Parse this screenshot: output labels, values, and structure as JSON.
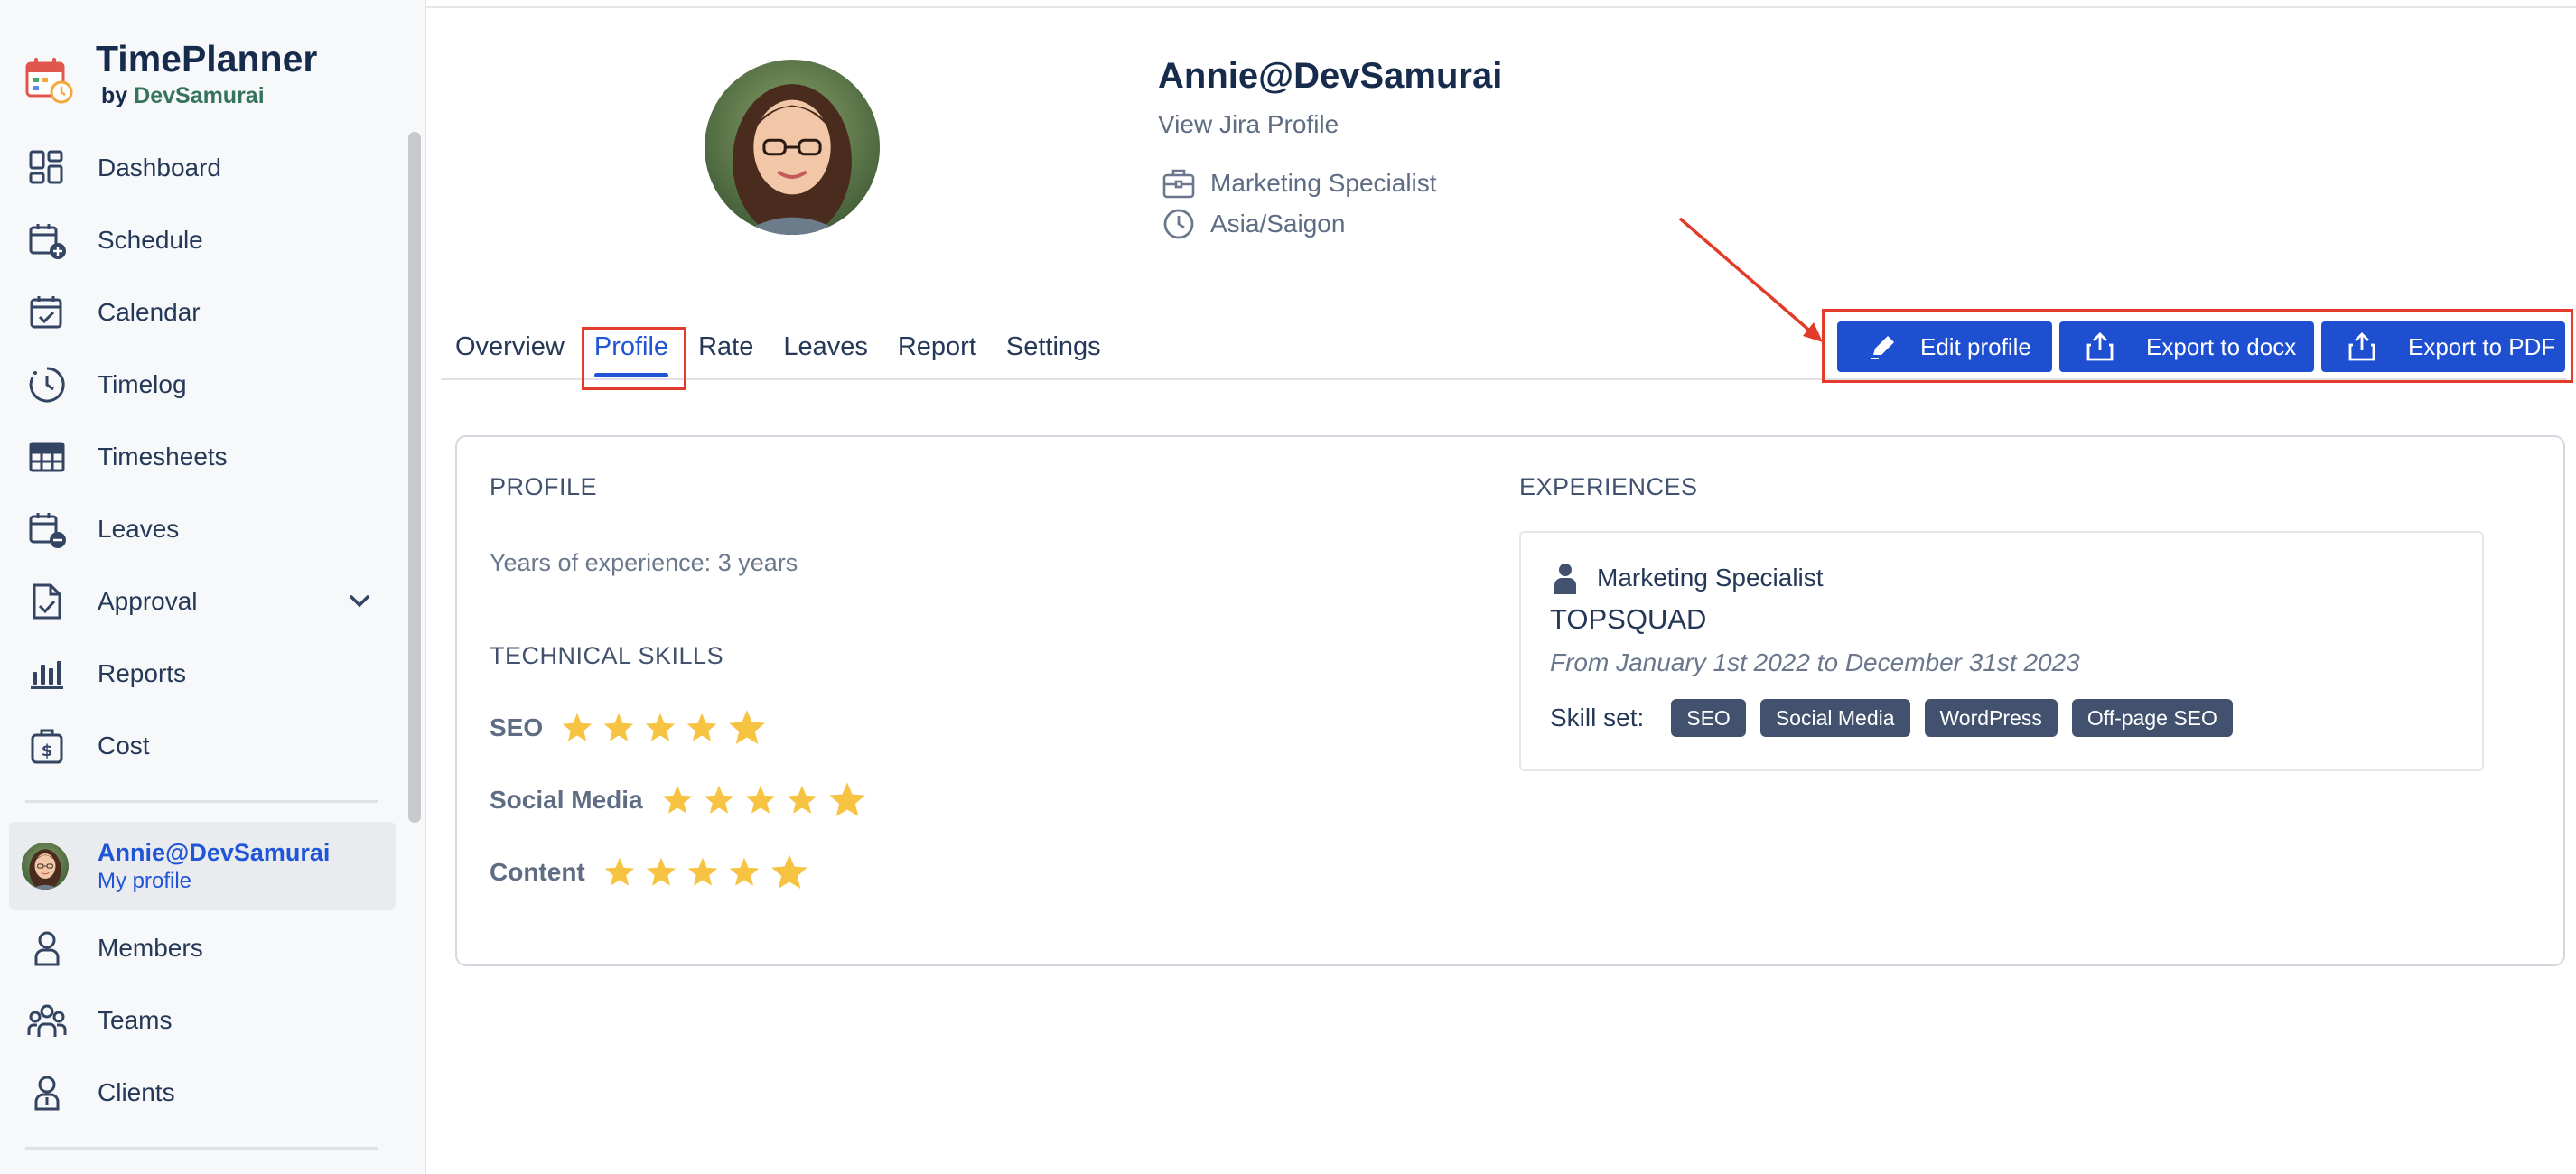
{
  "brand": {
    "title": "TimePlanner",
    "by": "by",
    "by_name": "DevSamurai"
  },
  "sidebar": {
    "items": [
      {
        "label": "Dashboard",
        "icon": "dashboard-icon"
      },
      {
        "label": "Schedule",
        "icon": "schedule-icon"
      },
      {
        "label": "Calendar",
        "icon": "calendar-icon"
      },
      {
        "label": "Timelog",
        "icon": "timelog-icon"
      },
      {
        "label": "Timesheets",
        "icon": "timesheets-icon"
      },
      {
        "label": "Leaves",
        "icon": "leaves-icon"
      },
      {
        "label": "Approval",
        "icon": "approval-icon"
      },
      {
        "label": "Reports",
        "icon": "reports-icon"
      },
      {
        "label": "Cost",
        "icon": "cost-icon"
      }
    ],
    "me": {
      "name": "Annie@DevSamurai",
      "link": "My profile"
    },
    "lower_items": [
      {
        "label": "Members",
        "icon": "members-icon"
      },
      {
        "label": "Teams",
        "icon": "teams-icon"
      },
      {
        "label": "Clients",
        "icon": "clients-icon"
      }
    ]
  },
  "profile_header": {
    "name": "Annie@DevSamurai",
    "jira_link": "View Jira Profile",
    "job_title": "Marketing Specialist",
    "timezone": "Asia/Saigon"
  },
  "tabs": [
    {
      "label": "Overview"
    },
    {
      "label": "Profile"
    },
    {
      "label": "Rate"
    },
    {
      "label": "Leaves"
    },
    {
      "label": "Report"
    },
    {
      "label": "Settings"
    }
  ],
  "active_tab": "Profile",
  "actions": {
    "edit": "Edit profile",
    "export_docx": "Export to docx",
    "export_pdf": "Export to PDF"
  },
  "profile": {
    "section_title": "PROFILE",
    "years_label": "Years of experience:",
    "years_value": "3 years",
    "skills_title": "TECHNICAL SKILLS",
    "skills": [
      {
        "name": "SEO",
        "rating": 5,
        "max": 5
      },
      {
        "name": "Social Media",
        "rating": 5,
        "max": 5
      },
      {
        "name": "Content",
        "rating": 5,
        "max": 5
      }
    ]
  },
  "experiences": {
    "section_title": "EXPERIENCES",
    "items": [
      {
        "role": "Marketing Specialist",
        "company": "TOPSQUAD",
        "dates": "From January 1st 2022 to December 31st 2023",
        "skillset_label": "Skill set:",
        "skills": [
          "SEO",
          "Social Media",
          "WordPress",
          "Off-page SEO"
        ]
      }
    ]
  },
  "colors": {
    "primary": "#1f4fd1",
    "link": "#1f55d6",
    "highlight": "#e23b2a",
    "star": "#f6c343",
    "chip": "#42526e"
  }
}
